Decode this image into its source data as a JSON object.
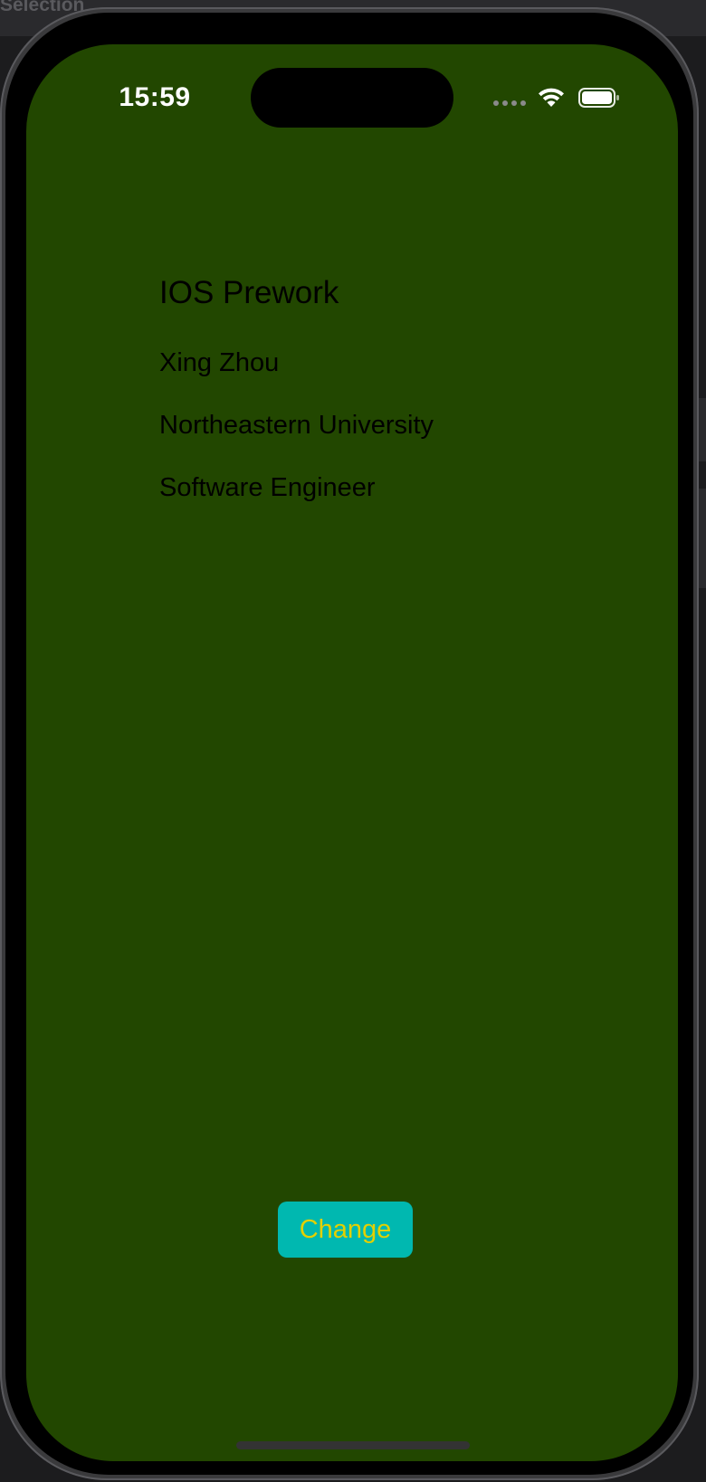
{
  "window": {
    "top_label": "Selection"
  },
  "status_bar": {
    "time": "15:59",
    "wifi_icon": "wifi-icon",
    "battery_icon": "battery-full-icon",
    "signal_icon": "signal-dots-icon"
  },
  "content": {
    "title": "IOS Prework",
    "name": "Xing Zhou",
    "school": "Northeastern University",
    "role": "Software Engineer"
  },
  "actions": {
    "change_label": "Change"
  },
  "colors": {
    "screen_background": "#224700",
    "button_background": "#00b8b0",
    "button_text": "#e3d000",
    "text": "#000000"
  }
}
